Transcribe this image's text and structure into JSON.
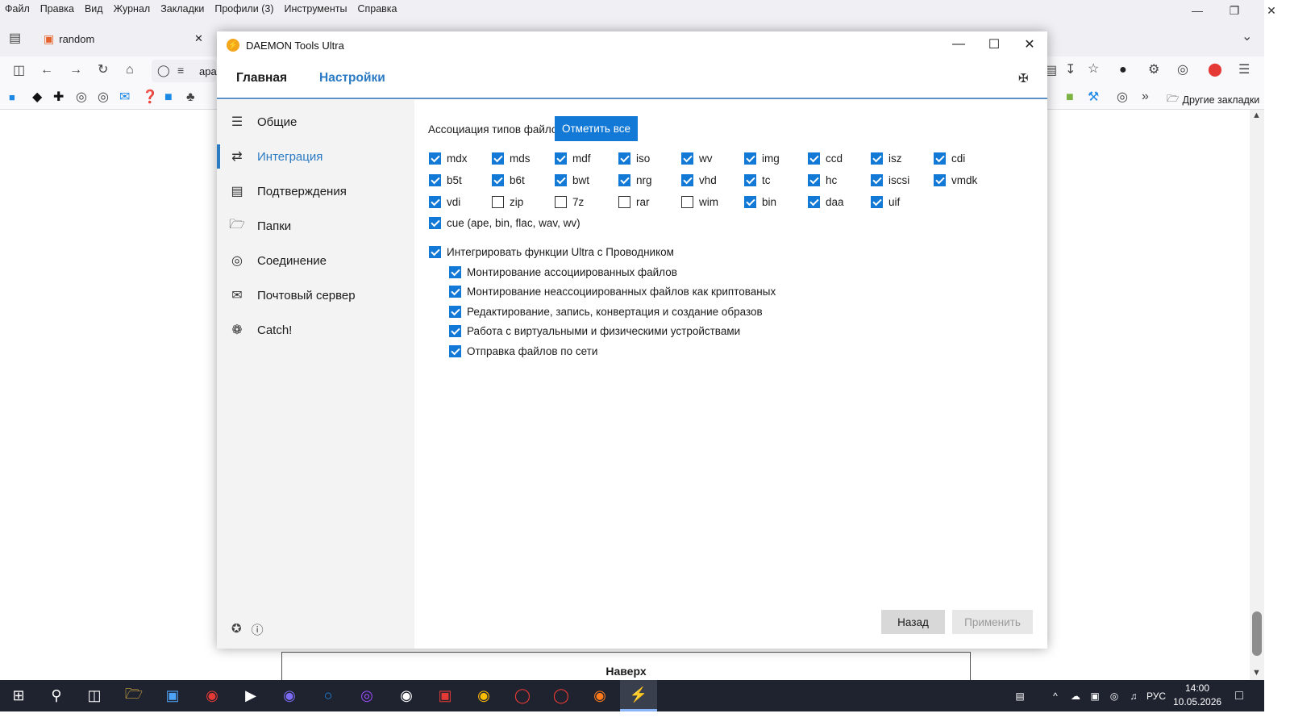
{
  "browser": {
    "menu": [
      "Файл",
      "Правка",
      "Вид",
      "Журнал",
      "Закладки",
      "Профили (3)",
      "Инструменты",
      "Справка"
    ],
    "tab_title": "random",
    "url_fragment": "apa",
    "other_bookmarks": "Другие закладки",
    "page_button": "Наверх"
  },
  "app": {
    "title": "DAEMON Tools Ultra",
    "tabs": {
      "main": "Главная",
      "settings": "Настройки"
    },
    "sidebar": [
      {
        "label": "Общие",
        "icon": "sliders-icon"
      },
      {
        "label": "Интеграция",
        "icon": "shuffle-icon",
        "selected": true
      },
      {
        "label": "Подтверждения",
        "icon": "document-icon"
      },
      {
        "label": "Папки",
        "icon": "folder-search-icon"
      },
      {
        "label": "Соединение",
        "icon": "globe-icon"
      },
      {
        "label": "Почтовый сервер",
        "icon": "envelope-icon"
      },
      {
        "label": "Catch!",
        "icon": "catch-icon"
      }
    ],
    "assoc_label": "Ассоциация типов файлов",
    "mark_all": "Отметить все",
    "filetypes": [
      {
        "ext": "mdx",
        "checked": true
      },
      {
        "ext": "mds",
        "checked": true
      },
      {
        "ext": "mdf",
        "checked": true
      },
      {
        "ext": "iso",
        "checked": true
      },
      {
        "ext": "wv",
        "checked": true
      },
      {
        "ext": "img",
        "checked": true
      },
      {
        "ext": "ccd",
        "checked": true
      },
      {
        "ext": "isz",
        "checked": true
      },
      {
        "ext": "cdi",
        "checked": true
      },
      {
        "ext": "b5t",
        "checked": true
      },
      {
        "ext": "b6t",
        "checked": true
      },
      {
        "ext": "bwt",
        "checked": true
      },
      {
        "ext": "nrg",
        "checked": true
      },
      {
        "ext": "vhd",
        "checked": true
      },
      {
        "ext": "tc",
        "checked": true
      },
      {
        "ext": "hc",
        "checked": true
      },
      {
        "ext": "iscsi",
        "checked": true
      },
      {
        "ext": "vmdk",
        "checked": true
      },
      {
        "ext": "vdi",
        "checked": true
      },
      {
        "ext": "zip",
        "checked": false
      },
      {
        "ext": "7z",
        "checked": false
      },
      {
        "ext": "rar",
        "checked": false
      },
      {
        "ext": "wim",
        "checked": false
      },
      {
        "ext": "bin",
        "checked": true
      },
      {
        "ext": "daa",
        "checked": true
      },
      {
        "ext": "uif",
        "checked": true
      }
    ],
    "cue": {
      "label": "cue (ape, bin, flac, wav, wv)",
      "checked": true
    },
    "integrate": {
      "label": "Интегрировать функции Ultra с Проводником",
      "checked": true
    },
    "sub_options": [
      {
        "label": "Монтирование ассоциированных файлов",
        "checked": true
      },
      {
        "label": "Монтирование неассоциированных файлов как криптованых",
        "checked": true
      },
      {
        "label": "Редактирование, запись, конвертация и создание образов",
        "checked": true
      },
      {
        "label": "Работа с виртуальными и физическими устройствами",
        "checked": true
      },
      {
        "label": "Отправка файлов по сети",
        "checked": true
      }
    ],
    "buttons": {
      "back": "Назад",
      "apply": "Применить"
    }
  },
  "taskbar": {
    "lang": "РУС",
    "time": "14:00",
    "date": "10.05.2026"
  }
}
